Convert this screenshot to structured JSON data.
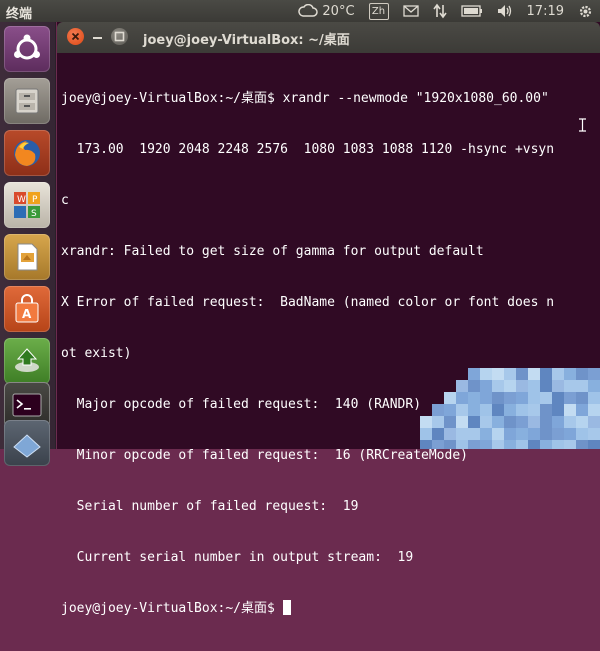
{
  "top_panel": {
    "app_title": "终端",
    "weather_icon": "cloud-icon",
    "temperature": "20°C",
    "input_method": "Zh",
    "clock": "17:19"
  },
  "launcher": {
    "items": [
      {
        "name": "dash-home",
        "icon": "ubuntu-logo-icon"
      },
      {
        "name": "files",
        "icon": "file-cabinet-icon"
      },
      {
        "name": "firefox",
        "icon": "firefox-icon"
      },
      {
        "name": "wps-office",
        "icon": "wps-icon"
      },
      {
        "name": "libreoffice-impress",
        "icon": "presentation-icon"
      },
      {
        "name": "software-center",
        "icon": "shopping-bag-icon"
      },
      {
        "name": "update-manager",
        "icon": "update-icon"
      },
      {
        "name": "terminal",
        "icon": "terminal-icon"
      },
      {
        "name": "workspace-switcher",
        "icon": "workspace-icon"
      }
    ]
  },
  "window": {
    "title": "joey@joey-VirtualBox: ~/桌面"
  },
  "terminal": {
    "lines": [
      "joey@joey-VirtualBox:~/桌面$ xrandr --newmode \"1920x1080_60.00\"",
      "  173.00  1920 2048 2248 2576  1080 1083 1088 1120 -hsync +vsyn",
      "c",
      "xrandr: Failed to get size of gamma for output default",
      "X Error of failed request:  BadName (named color or font does n",
      "ot exist)",
      "  Major opcode of failed request:  140 (RANDR)",
      "  Minor opcode of failed request:  16 (RRCreateMode)",
      "  Serial number of failed request:  19",
      "  Current serial number in output stream:  19"
    ],
    "prompt": "joey@joey-VirtualBox:~/桌面$ "
  },
  "colors": {
    "terminal_bg": "#300a24",
    "close_button": "#dd4814",
    "panel_bg": "#3c3b37"
  }
}
